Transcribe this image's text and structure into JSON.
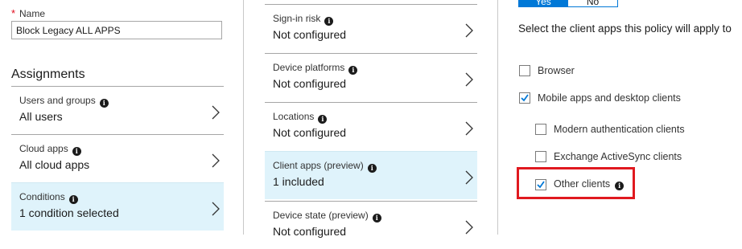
{
  "name_field": {
    "required_marker": "*",
    "label": "Name",
    "value": "Block Legacy ALL APPS"
  },
  "assignments": {
    "title": "Assignments",
    "items": [
      {
        "label": "Users and groups",
        "value": "All users"
      },
      {
        "label": "Cloud apps",
        "value": "All cloud apps"
      },
      {
        "label": "Conditions",
        "value": "1 condition selected",
        "selected": true
      }
    ]
  },
  "conditions": {
    "items": [
      {
        "label": "Sign-in risk",
        "value": "Not configured"
      },
      {
        "label": "Device platforms",
        "value": "Not configured"
      },
      {
        "label": "Locations",
        "value": "Not configured"
      },
      {
        "label": "Client apps (preview)",
        "value": "1 included",
        "selected": true
      },
      {
        "label": "Device state (preview)",
        "value": "Not configured"
      }
    ]
  },
  "client_apps": {
    "configure_toggle": {
      "yes": "Yes",
      "no": "No",
      "selected": "yes"
    },
    "instruction": "Select the client apps this policy will apply to",
    "options": [
      {
        "label": "Browser",
        "checked": false
      },
      {
        "label": "Mobile apps and desktop clients",
        "checked": true
      },
      {
        "label": "Modern authentication clients",
        "checked": false
      },
      {
        "label": "Exchange ActiveSync clients",
        "checked": false
      },
      {
        "label": "Other clients",
        "checked": true
      }
    ]
  },
  "colors": {
    "accent": "#0078d7",
    "selected_row": "#dff3fb",
    "highlight_box": "#e0191f"
  }
}
